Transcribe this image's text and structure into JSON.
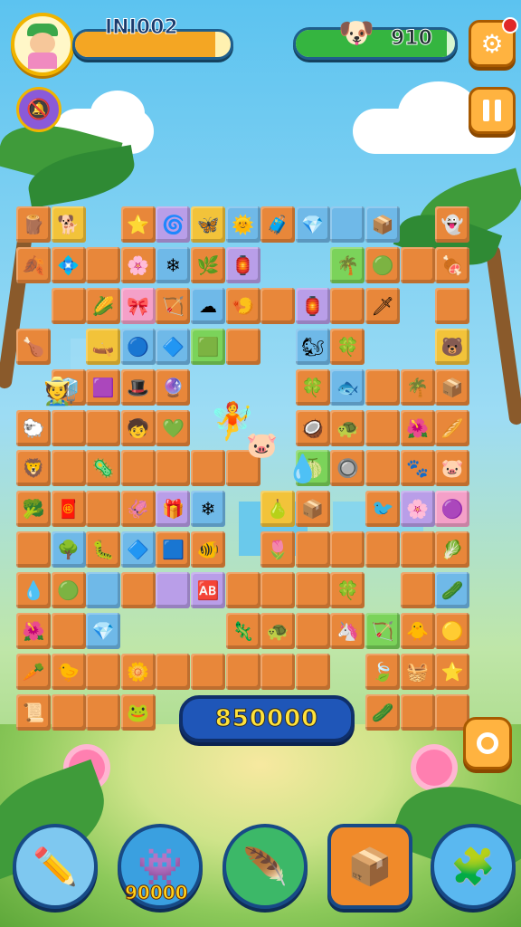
{
  "hud": {
    "player_name": "INI002",
    "player_bar_fill": 0.9,
    "coins_value": "910",
    "coins_bar_fill": 0.95,
    "colors": {
      "orange_bar": "#f4a623",
      "green_bar": "#35b540",
      "accent": "#ffb340"
    }
  },
  "buttons": {
    "settings_icon": "gear-icon",
    "sound_icon": "muted-bell-icon",
    "pause_icon": "pause-icon",
    "target_icon": "target-icon"
  },
  "board": {
    "score": "850000",
    "tiles": [
      {
        "c": 0,
        "r": 0,
        "g": "🪵",
        "bg": "#e8873a"
      },
      {
        "c": 1,
        "r": 0,
        "g": "🐕",
        "bg": "#f2c33a"
      },
      {
        "c": 3,
        "r": 0,
        "g": "⭐",
        "bg": "#e8873a"
      },
      {
        "c": 4,
        "r": 0,
        "g": "🌀",
        "bg": "#b99ee8"
      },
      {
        "c": 5,
        "r": 0,
        "g": "🦋",
        "bg": "#f2c33a"
      },
      {
        "c": 6,
        "r": 0,
        "g": "🌞",
        "bg": "#6fb9e8"
      },
      {
        "c": 7,
        "r": 0,
        "g": "🧳",
        "bg": "#e8873a"
      },
      {
        "c": 8,
        "r": 0,
        "g": "💎",
        "bg": "#6fb9e8"
      },
      {
        "c": 9,
        "r": 0,
        "g": "",
        "bg": "#6fb9e8"
      },
      {
        "c": 10,
        "r": 0,
        "g": "📦",
        "bg": "#6fb9e8"
      },
      {
        "c": 12,
        "r": 0,
        "g": "👻",
        "bg": "#e8873a"
      },
      {
        "c": 0,
        "r": 1,
        "g": "🍂",
        "bg": "#e8873a"
      },
      {
        "c": 1,
        "r": 1,
        "g": "💠",
        "bg": "#e8873a"
      },
      {
        "c": 2,
        "r": 1,
        "g": "",
        "bg": "#e8873a"
      },
      {
        "c": 3,
        "r": 1,
        "g": "🌸",
        "bg": "#e8873a"
      },
      {
        "c": 4,
        "r": 1,
        "g": "❄",
        "bg": "#6fb9e8"
      },
      {
        "c": 5,
        "r": 1,
        "g": "🌿",
        "bg": "#e8873a"
      },
      {
        "c": 6,
        "r": 1,
        "g": "🏮",
        "bg": "#b99ee8"
      },
      {
        "c": 9,
        "r": 1,
        "g": "🌴",
        "bg": "#7bd35a"
      },
      {
        "c": 10,
        "r": 1,
        "g": "🟢",
        "bg": "#e8873a"
      },
      {
        "c": 11,
        "r": 1,
        "g": "",
        "bg": "#e8873a"
      },
      {
        "c": 12,
        "r": 1,
        "g": "🍖",
        "bg": "#e8873a"
      },
      {
        "c": 1,
        "r": 2,
        "g": "",
        "bg": "#e8873a"
      },
      {
        "c": 2,
        "r": 2,
        "g": "🌽",
        "bg": "#e8873a"
      },
      {
        "c": 3,
        "r": 2,
        "g": "🎀",
        "bg": "#f4a0c8"
      },
      {
        "c": 4,
        "r": 2,
        "g": "🏹",
        "bg": "#e8873a"
      },
      {
        "c": 5,
        "r": 2,
        "g": "☁",
        "bg": "#6fb9e8"
      },
      {
        "c": 6,
        "r": 2,
        "g": "🍤",
        "bg": "#e8873a"
      },
      {
        "c": 7,
        "r": 2,
        "g": "",
        "bg": "#e8873a"
      },
      {
        "c": 8,
        "r": 2,
        "g": "🏮",
        "bg": "#b99ee8"
      },
      {
        "c": 9,
        "r": 2,
        "g": "",
        "bg": "#e8873a"
      },
      {
        "c": 10,
        "r": 2,
        "g": "🗡",
        "bg": "#e8873a"
      },
      {
        "c": 12,
        "r": 2,
        "g": "",
        "bg": "#e8873a"
      },
      {
        "c": 0,
        "r": 3,
        "g": "🍗",
        "bg": "#e8873a"
      },
      {
        "c": 2,
        "r": 3,
        "g": "🛶",
        "bg": "#f2c33a"
      },
      {
        "c": 3,
        "r": 3,
        "g": "🔵",
        "bg": "#6fb9e8"
      },
      {
        "c": 4,
        "r": 3,
        "g": "🔷",
        "bg": "#6fb9e8"
      },
      {
        "c": 5,
        "r": 3,
        "g": "🟩",
        "bg": "#7bd35a"
      },
      {
        "c": 6,
        "r": 3,
        "g": "",
        "bg": "#e8873a"
      },
      {
        "c": 8,
        "r": 3,
        "g": "🐿",
        "bg": "#6fb9e8"
      },
      {
        "c": 9,
        "r": 3,
        "g": "🍀",
        "bg": "#e8873a"
      },
      {
        "c": 12,
        "r": 3,
        "g": "🐻",
        "bg": "#f2c33a"
      },
      {
        "c": 1,
        "r": 4,
        "g": "🧊",
        "bg": "#e8873a"
      },
      {
        "c": 2,
        "r": 4,
        "g": "🟪",
        "bg": "#e8873a"
      },
      {
        "c": 3,
        "r": 4,
        "g": "🎩",
        "bg": "#e8873a"
      },
      {
        "c": 4,
        "r": 4,
        "g": "🔮",
        "bg": "#e8873a"
      },
      {
        "c": 8,
        "r": 4,
        "g": "🍀",
        "bg": "#e8873a"
      },
      {
        "c": 9,
        "r": 4,
        "g": "🐟",
        "bg": "#6fb9e8"
      },
      {
        "c": 10,
        "r": 4,
        "g": "",
        "bg": "#e8873a"
      },
      {
        "c": 11,
        "r": 4,
        "g": "🌴",
        "bg": "#e8873a"
      },
      {
        "c": 12,
        "r": 4,
        "g": "📦",
        "bg": "#e8873a"
      },
      {
        "c": 0,
        "r": 5,
        "g": "🐑",
        "bg": "#e8873a"
      },
      {
        "c": 1,
        "r": 5,
        "g": "",
        "bg": "#e8873a"
      },
      {
        "c": 2,
        "r": 5,
        "g": "",
        "bg": "#e8873a"
      },
      {
        "c": 3,
        "r": 5,
        "g": "🧒",
        "bg": "#e8873a"
      },
      {
        "c": 4,
        "r": 5,
        "g": "💚",
        "bg": "#e8873a"
      },
      {
        "c": 8,
        "r": 5,
        "g": "🥥",
        "bg": "#e8873a"
      },
      {
        "c": 9,
        "r": 5,
        "g": "🐢",
        "bg": "#e8873a"
      },
      {
        "c": 10,
        "r": 5,
        "g": "",
        "bg": "#e8873a"
      },
      {
        "c": 11,
        "r": 5,
        "g": "🌺",
        "bg": "#e8873a"
      },
      {
        "c": 12,
        "r": 5,
        "g": "🥖",
        "bg": "#e8873a"
      },
      {
        "c": 0,
        "r": 6,
        "g": "🦁",
        "bg": "#e8873a"
      },
      {
        "c": 1,
        "r": 6,
        "g": "",
        "bg": "#e8873a"
      },
      {
        "c": 2,
        "r": 6,
        "g": "🦠",
        "bg": "#e8873a"
      },
      {
        "c": 3,
        "r": 6,
        "g": "",
        "bg": "#e8873a"
      },
      {
        "c": 4,
        "r": 6,
        "g": "",
        "bg": "#e8873a"
      },
      {
        "c": 5,
        "r": 6,
        "g": "",
        "bg": "#e8873a"
      },
      {
        "c": 6,
        "r": 6,
        "g": "",
        "bg": "#e8873a"
      },
      {
        "c": 8,
        "r": 6,
        "g": "🍈",
        "bg": "#7bd35a"
      },
      {
        "c": 9,
        "r": 6,
        "g": "🔘",
        "bg": "#e8873a"
      },
      {
        "c": 10,
        "r": 6,
        "g": "",
        "bg": "#e8873a"
      },
      {
        "c": 11,
        "r": 6,
        "g": "🐾",
        "bg": "#e8873a"
      },
      {
        "c": 12,
        "r": 6,
        "g": "🐷",
        "bg": "#e8873a"
      },
      {
        "c": 0,
        "r": 7,
        "g": "🥦",
        "bg": "#e8873a"
      },
      {
        "c": 1,
        "r": 7,
        "g": "🧧",
        "bg": "#e8873a"
      },
      {
        "c": 2,
        "r": 7,
        "g": "",
        "bg": "#e8873a"
      },
      {
        "c": 3,
        "r": 7,
        "g": "🦑",
        "bg": "#e8873a"
      },
      {
        "c": 4,
        "r": 7,
        "g": "🎁",
        "bg": "#b99ee8"
      },
      {
        "c": 5,
        "r": 7,
        "g": "❄",
        "bg": "#6fb9e8"
      },
      {
        "c": 7,
        "r": 7,
        "g": "🍐",
        "bg": "#f2c33a"
      },
      {
        "c": 8,
        "r": 7,
        "g": "📦",
        "bg": "#e8873a"
      },
      {
        "c": 10,
        "r": 7,
        "g": "🐦",
        "bg": "#e8873a"
      },
      {
        "c": 11,
        "r": 7,
        "g": "🌸",
        "bg": "#b99ee8"
      },
      {
        "c": 12,
        "r": 7,
        "g": "🟣",
        "bg": "#f4a0c8"
      },
      {
        "c": 0,
        "r": 8,
        "g": "",
        "bg": "#e8873a"
      },
      {
        "c": 1,
        "r": 8,
        "g": "🌳",
        "bg": "#6fb9e8"
      },
      {
        "c": 2,
        "r": 8,
        "g": "🐛",
        "bg": "#e8873a"
      },
      {
        "c": 3,
        "r": 8,
        "g": "🔷",
        "bg": "#6fb9e8"
      },
      {
        "c": 4,
        "r": 8,
        "g": "🟦",
        "bg": "#e8873a"
      },
      {
        "c": 5,
        "r": 8,
        "g": "🐠",
        "bg": "#e8873a"
      },
      {
        "c": 7,
        "r": 8,
        "g": "🌷",
        "bg": "#e8873a"
      },
      {
        "c": 8,
        "r": 8,
        "g": "",
        "bg": "#e8873a"
      },
      {
        "c": 9,
        "r": 8,
        "g": "",
        "bg": "#e8873a"
      },
      {
        "c": 10,
        "r": 8,
        "g": "",
        "bg": "#e8873a"
      },
      {
        "c": 11,
        "r": 8,
        "g": "",
        "bg": "#e8873a"
      },
      {
        "c": 12,
        "r": 8,
        "g": "🥬",
        "bg": "#e8873a"
      },
      {
        "c": 0,
        "r": 9,
        "g": "💧",
        "bg": "#e8873a"
      },
      {
        "c": 1,
        "r": 9,
        "g": "🟢",
        "bg": "#e8873a"
      },
      {
        "c": 2,
        "r": 9,
        "g": "",
        "bg": "#6fb9e8"
      },
      {
        "c": 3,
        "r": 9,
        "g": "",
        "bg": "#e8873a"
      },
      {
        "c": 4,
        "r": 9,
        "g": "",
        "bg": "#b99ee8"
      },
      {
        "c": 5,
        "r": 9,
        "g": "🆎",
        "bg": "#b99ee8"
      },
      {
        "c": 6,
        "r": 9,
        "g": "",
        "bg": "#e8873a"
      },
      {
        "c": 7,
        "r": 9,
        "g": "",
        "bg": "#e8873a"
      },
      {
        "c": 8,
        "r": 9,
        "g": "",
        "bg": "#e8873a"
      },
      {
        "c": 9,
        "r": 9,
        "g": "🍀",
        "bg": "#e8873a"
      },
      {
        "c": 11,
        "r": 9,
        "g": "",
        "bg": "#e8873a"
      },
      {
        "c": 12,
        "r": 9,
        "g": "🥒",
        "bg": "#6fb9e8"
      },
      {
        "c": 0,
        "r": 10,
        "g": "🌺",
        "bg": "#e8873a"
      },
      {
        "c": 1,
        "r": 10,
        "g": "",
        "bg": "#e8873a"
      },
      {
        "c": 2,
        "r": 10,
        "g": "💎",
        "bg": "#6fb9e8"
      },
      {
        "c": 6,
        "r": 10,
        "g": "🦎",
        "bg": "#e8873a"
      },
      {
        "c": 7,
        "r": 10,
        "g": "🐢",
        "bg": "#e8873a"
      },
      {
        "c": 8,
        "r": 10,
        "g": "",
        "bg": "#e8873a"
      },
      {
        "c": 9,
        "r": 10,
        "g": "🦄",
        "bg": "#e8873a"
      },
      {
        "c": 10,
        "r": 10,
        "g": "🏹",
        "bg": "#7bd35a"
      },
      {
        "c": 11,
        "r": 10,
        "g": "🐥",
        "bg": "#e8873a"
      },
      {
        "c": 12,
        "r": 10,
        "g": "🟡",
        "bg": "#e8873a"
      },
      {
        "c": 0,
        "r": 11,
        "g": "🥕",
        "bg": "#e8873a"
      },
      {
        "c": 1,
        "r": 11,
        "g": "🐤",
        "bg": "#e8873a"
      },
      {
        "c": 2,
        "r": 11,
        "g": "",
        "bg": "#e8873a"
      },
      {
        "c": 3,
        "r": 11,
        "g": "🌼",
        "bg": "#e8873a"
      },
      {
        "c": 4,
        "r": 11,
        "g": "",
        "bg": "#e8873a"
      },
      {
        "c": 5,
        "r": 11,
        "g": "",
        "bg": "#e8873a"
      },
      {
        "c": 6,
        "r": 11,
        "g": "",
        "bg": "#e8873a"
      },
      {
        "c": 7,
        "r": 11,
        "g": "",
        "bg": "#e8873a"
      },
      {
        "c": 8,
        "r": 11,
        "g": "",
        "bg": "#e8873a"
      },
      {
        "c": 10,
        "r": 11,
        "g": "🍃",
        "bg": "#e8873a"
      },
      {
        "c": 11,
        "r": 11,
        "g": "🧺",
        "bg": "#e8873a"
      },
      {
        "c": 12,
        "r": 11,
        "g": "⭐",
        "bg": "#e8873a"
      },
      {
        "c": 0,
        "r": 12,
        "g": "📜",
        "bg": "#e8873a"
      },
      {
        "c": 1,
        "r": 12,
        "g": "",
        "bg": "#e8873a"
      },
      {
        "c": 2,
        "r": 12,
        "g": "",
        "bg": "#e8873a"
      },
      {
        "c": 3,
        "r": 12,
        "g": "🐸",
        "bg": "#e8873a"
      },
      {
        "c": 10,
        "r": 12,
        "g": "🥒",
        "bg": "#e8873a"
      },
      {
        "c": 11,
        "r": 12,
        "g": "",
        "bg": "#e8873a"
      },
      {
        "c": 12,
        "r": 12,
        "g": "",
        "bg": "#e8873a"
      }
    ]
  },
  "powerups": [
    {
      "name": "pencil-powerup",
      "icon": "✏️",
      "bg": "#7ec8f0",
      "label": ""
    },
    {
      "name": "monster-powerup",
      "icon": "👾",
      "bg": "#3aa0e0",
      "label": "90000"
    },
    {
      "name": "feather-powerup",
      "icon": "🪶",
      "bg": "#3cb868",
      "label": ""
    },
    {
      "name": "box-powerup",
      "icon": "📦",
      "bg": "#f08a2a",
      "label": ""
    },
    {
      "name": "puzzle-powerup",
      "icon": "🧩",
      "bg": "#5ab8f0",
      "label": ""
    }
  ]
}
